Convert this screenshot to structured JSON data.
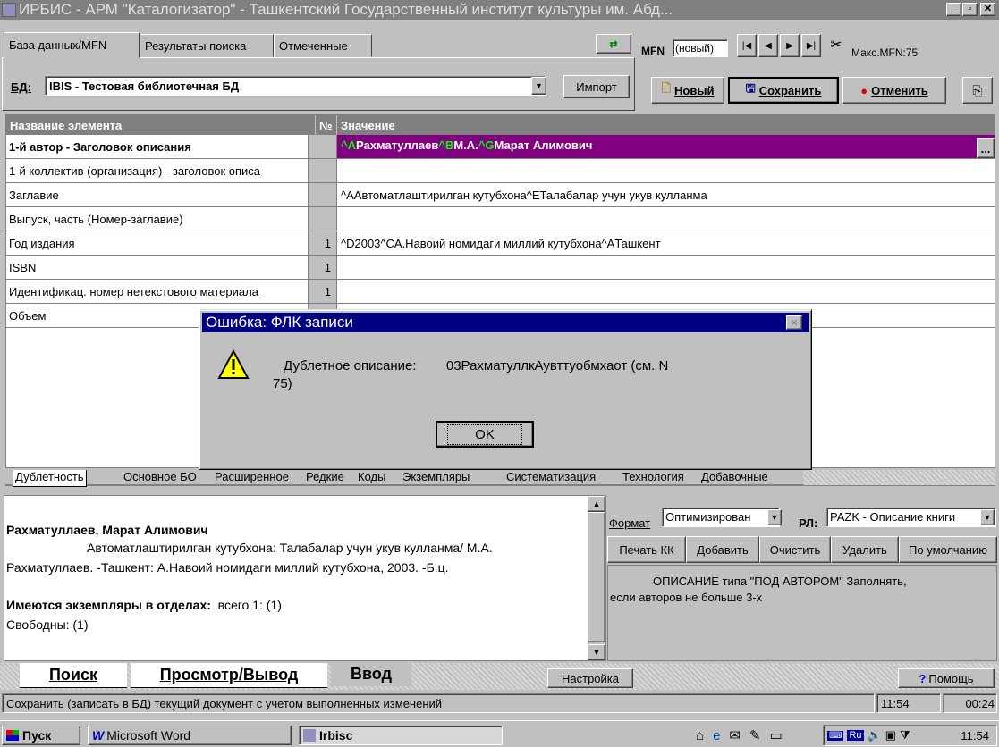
{
  "window": {
    "title": "ИРБИС - АРМ \"Каталогизатор\" - Ташкентский Государственный институт культуры им. Абд..."
  },
  "tabs": [
    "База данных/MFN",
    "Результаты поиска",
    "Отмеченные"
  ],
  "db": {
    "label": "БД:",
    "value": "IBIS - Тестовая библиотечная БД",
    "import": "Импорт"
  },
  "mfn": {
    "label": "MFN",
    "value": "(новый)",
    "max": "Макс.MFN:75"
  },
  "actions": {
    "new": "Новый",
    "save": "Сохранить",
    "cancel": "Отменить"
  },
  "grid": {
    "headers": [
      "Название элемента",
      "№",
      "Значение"
    ],
    "rows": [
      {
        "name": "1-й автор - Заголовок описания",
        "num": "",
        "v": [
          "^A",
          "Рахматуллаев",
          "^B",
          "М.А.",
          "^G",
          "Марат Алимович"
        ]
      },
      {
        "name": "1-й коллектив (организация) - заголовок описа",
        "num": "",
        "value": ""
      },
      {
        "name": "Заглавие",
        "num": "",
        "value": "^AАвтоматлаштирилган кутубхона^EТалабалар учун укув кулланма"
      },
      {
        "name": "Выпуск, часть (Номер-заглавие)",
        "num": "",
        "value": ""
      },
      {
        "name": "Год издания",
        "num": "1",
        "value": "^D2003^CA.Навоий номидаги миллий кутубхона^AТашкент"
      },
      {
        "name": "ISBN",
        "num": "1",
        "value": ""
      },
      {
        "name": "Идентификац. номер нетекстового материала",
        "num": "1",
        "value": ""
      },
      {
        "name": "Объем",
        "num": "",
        "value": ""
      }
    ],
    "ellipsis": "..."
  },
  "bottom_tabs": [
    "Дублетность",
    "Основное БО",
    "Расширенное",
    "Редкие",
    "Коды",
    "Экземпляры",
    "Систематизация",
    "Технология",
    "Добавочные"
  ],
  "dialog": {
    "title": "Ошибка: ФЛК записи",
    "message": "Дублетное описание:        03РахматуллкАувттуобмхаот (см. N",
    "message2": "75)",
    "ok": "OK",
    "close": "✕"
  },
  "preview": {
    "author": "Рахматуллаев, Марат Алимович",
    "line1": "Автоматлаштирилган кутубхона: Талабалар учун укув кулланма/ М.А.",
    "line2": "Рахматуллаев. -Ташкент: А.Навоий номидаги миллий кутубхона, 2003. -Б.ц.",
    "holdings_label": "Имеются экземпляры в отделах:",
    "holdings_value": "всего 1: (1)",
    "free": "Свободны: (1)"
  },
  "format": {
    "label": "Формат",
    "value": "Оптимизирован",
    "rl_label": "РЛ:",
    "rl_value": "PAZK - Описание книги"
  },
  "fmt_buttons": [
    "Печать КК",
    "Добавить",
    "Очистить",
    "Удалить",
    "По умолчанию"
  ],
  "description": {
    "line1": "ОПИСАНИЕ типа \"ПОД АВТОРОМ\"      Заполнять,",
    "line2": "если авторов не больше 3-х"
  },
  "main_tabs": [
    "Поиск",
    "Просмотр/Вывод",
    "Ввод"
  ],
  "settings": "Настройка",
  "help": "Помощь",
  "status": {
    "text": "Сохранить (записать в БД) текущий документ с учетом выполненных изменений",
    "time": "11:54",
    "elapsed": "00:24"
  },
  "taskbar": {
    "start": "Пуск",
    "word": "Microsoft Word",
    "irbis": "Irbisc",
    "lang": "Ru",
    "clock": "11:54"
  },
  "colors": {
    "selected_row": "#800080",
    "title_inactive": "#808080",
    "dialog_title": "#000080"
  }
}
